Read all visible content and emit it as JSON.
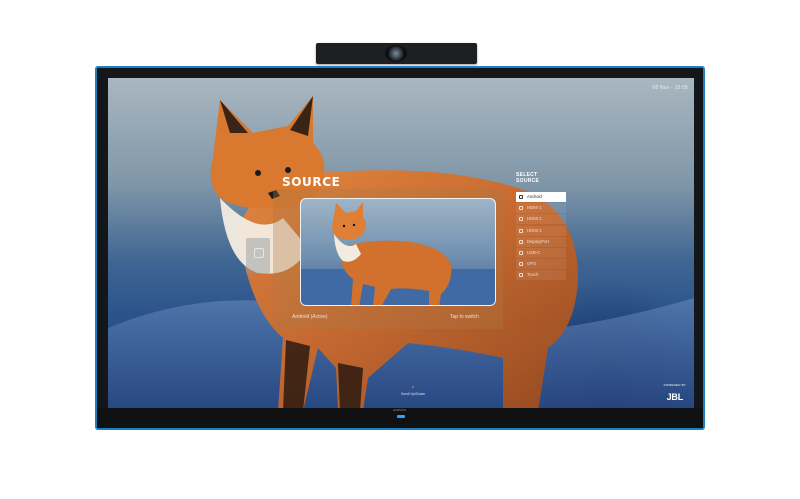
{
  "screen": {
    "clock": "08 Nov - 15:05",
    "source_title": "SOURCE",
    "active_source_label": "Android (Active)",
    "tap_to_switch": "Tap to switch",
    "select_source_header": [
      "SELECT",
      "SOURCE"
    ],
    "sources": [
      {
        "label": "Android",
        "icon": "android-icon",
        "active": true
      },
      {
        "label": "HDMI 1",
        "icon": "hdmi-icon",
        "active": false
      },
      {
        "label": "HDMI 2",
        "icon": "hdmi-icon",
        "active": false
      },
      {
        "label": "HDMI 3",
        "icon": "hdmi-icon",
        "active": false
      },
      {
        "label": "DisplayPort",
        "icon": "displayport-icon",
        "active": false
      },
      {
        "label": "USB-C",
        "icon": "usb-c-icon",
        "active": false
      },
      {
        "label": "OPS",
        "icon": "ops-icon",
        "active": false
      },
      {
        "label": "Touch",
        "icon": "touch-icon",
        "active": false
      }
    ],
    "scroll_hint": "Scroll Up/Down",
    "powered_by": "POWERED BY",
    "brand_logo": "JBL"
  },
  "bezel": {
    "brand": "HARMAN"
  },
  "colors": {
    "bezel_accent": "#1f7fc0",
    "active_item_bg": "#ffffff",
    "led": "#2fa3ff"
  }
}
